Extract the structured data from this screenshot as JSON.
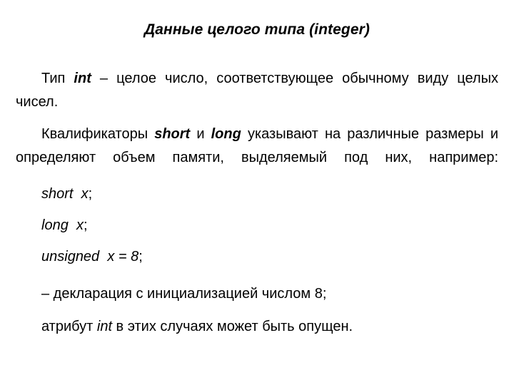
{
  "document": {
    "background_color": "#ffffff",
    "text_color": "#000000",
    "language": "ru",
    "title": {
      "text_before": "Данные целого типа (",
      "latin_term": "integer",
      "text_after": ")"
    },
    "paragraphs": [
      {
        "id": "para-int",
        "seg1": "Тип ",
        "term": "int",
        "seg2": " – целое число, соответствующее обычному виду целых чисел."
      },
      {
        "id": "para-qualifiers",
        "seg1": "Квалификаторы ",
        "term1": "short",
        "seg2": " и ",
        "term2": "long",
        "seg3": " указывают на различные размеры и определяют объем памяти, выделяемый под них, например:"
      }
    ],
    "code_lines": [
      {
        "id": "code-short",
        "keyword": "short",
        "spacer": "  ",
        "expression": "x",
        "terminator": ";"
      },
      {
        "id": "code-long",
        "keyword": "long",
        "spacer": "  ",
        "expression": "x",
        "terminator": ";"
      },
      {
        "id": "code-unsigned",
        "keyword": "unsigned",
        "spacer": "  ",
        "expression": "x = 8",
        "terminator": ";"
      }
    ],
    "notes": [
      {
        "id": "note-declaration",
        "text": "– декларация с инициализацией числом 8;"
      },
      {
        "id": "note-attribute",
        "seg1": "атрибут ",
        "term": "int",
        "seg2": " в этих случаях может быть опущен."
      }
    ]
  }
}
